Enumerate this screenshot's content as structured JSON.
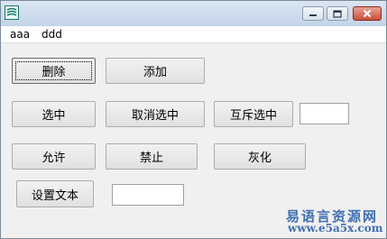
{
  "menu": {
    "items": [
      {
        "label": "aaa"
      },
      {
        "label": "ddd"
      }
    ]
  },
  "buttons": {
    "delete": "删除",
    "add": "添加",
    "select": "选中",
    "unselect": "取消选中",
    "exclusive_select": "互斥选中",
    "allow": "允许",
    "forbid": "禁止",
    "gray": "灰化",
    "set_text": "设置文本"
  },
  "inputs": {
    "textbox_1": "",
    "textbox_2": ""
  },
  "watermark": {
    "site_name": "易语言资源网",
    "url": "www.e5a5x.com",
    "color": "#3f6fb0"
  }
}
